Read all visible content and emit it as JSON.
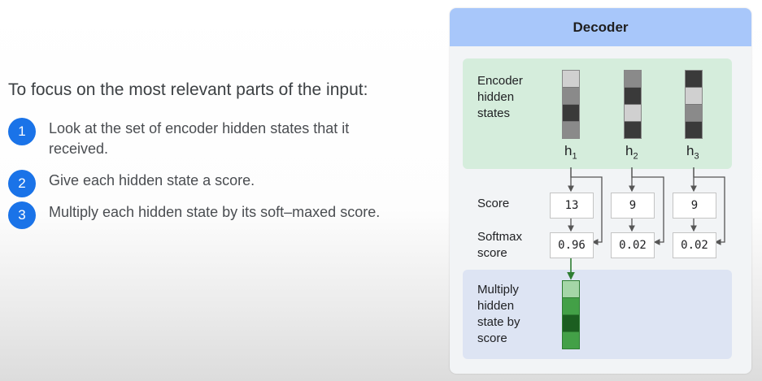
{
  "left": {
    "heading": "To focus on the most relevant parts of the input:",
    "steps": [
      {
        "num": "1",
        "text": "Look at the set of encoder hidden states that it received."
      },
      {
        "num": "2",
        "text": "Give each hidden state a score."
      },
      {
        "num": "3",
        "text": "Multiply each hidden state by its soft–maxed score."
      }
    ]
  },
  "panel": {
    "title": "Decoder",
    "encoder_label": "Encoder hidden states",
    "score_label": "Score",
    "softmax_label": "Softmax score",
    "multiply_label": "Multiply hidden state by score",
    "states": [
      {
        "h": "h",
        "sub": "1",
        "score": "13",
        "softmax": "0.96",
        "cells": [
          "#d0d0d0",
          "#8a8a8a",
          "#3a3a3a",
          "#8a8a8a"
        ]
      },
      {
        "h": "h",
        "sub": "2",
        "score": "9",
        "softmax": "0.02",
        "cells": [
          "#8a8a8a",
          "#3a3a3a",
          "#d0d0d0",
          "#3a3a3a"
        ]
      },
      {
        "h": "h",
        "sub": "3",
        "score": "9",
        "softmax": "0.02",
        "cells": [
          "#3a3a3a",
          "#d0d0d0",
          "#8a8a8a",
          "#3a3a3a"
        ]
      }
    ],
    "weighted_cells": [
      "#a5d6a7",
      "#43a047",
      "#1b5e20",
      "#43a047"
    ],
    "colors": {
      "header": "#a8c7fa",
      "encoder_bg": "#d5eddc",
      "multiply_bg": "#dde4f3",
      "badge": "#1a73e8",
      "arrow": "#555555",
      "green_arrow": "#2e7d32"
    }
  }
}
